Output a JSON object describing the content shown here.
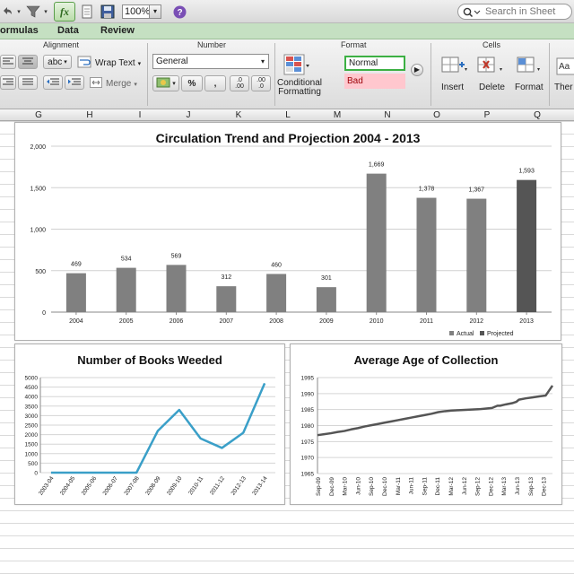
{
  "toolbar": {
    "zoom": "100%",
    "search_placeholder": "Search in Sheet",
    "icons": [
      "undo-icon",
      "filter-icon",
      "fx-icon",
      "document-icon",
      "save-icon",
      "help-icon"
    ]
  },
  "tabs": [
    "ormulas",
    "Data",
    "Review"
  ],
  "ribbon": {
    "alignment": {
      "title": "Alignment",
      "wrap_text": "Wrap Text",
      "merge": "Merge",
      "abc": "abc"
    },
    "number": {
      "title": "Number",
      "format": "General",
      "percent": "%",
      "comma": ",",
      "dec_inc": ".0\n.00",
      "dec_dec": ".00\n.0"
    },
    "format": {
      "title": "Format",
      "conditional": "Conditional Formatting",
      "normal": "Normal",
      "bad": "Bad"
    },
    "cells": {
      "title": "Cells",
      "insert": "Insert",
      "delete": "Delete",
      "format": "Format"
    },
    "themes": {
      "label": "Ther"
    }
  },
  "columns": [
    "G",
    "H",
    "I",
    "J",
    "K",
    "L",
    "M",
    "N",
    "O",
    "P",
    "Q"
  ],
  "chart_data": [
    {
      "type": "bar",
      "title": "Circulation Trend and Projection 2004 - 2013",
      "categories": [
        "2004",
        "2005",
        "2006",
        "2007",
        "2008",
        "2009",
        "2010",
        "2011",
        "2012",
        "2013"
      ],
      "values": [
        469,
        534,
        569,
        312,
        460,
        301,
        1669,
        1378,
        1367,
        1593
      ],
      "value_labels": [
        "469",
        "534",
        "569",
        "312",
        "460",
        "301",
        "1,669",
        "1,378",
        "1,367",
        "1,593"
      ],
      "projected_from_index": 9,
      "ylim": [
        0,
        2000
      ],
      "yticks": [
        "0",
        "500",
        "1,000",
        "1,500",
        "2,000"
      ],
      "legend": [
        "Actual",
        "Projected"
      ],
      "legend_position": "bottom-right",
      "colors": {
        "actual": "#808080",
        "projected": "#555555"
      }
    },
    {
      "type": "line",
      "title": "Number of Books Weeded",
      "categories": [
        "2003-04",
        "2004-05",
        "2005-06",
        "2006-07",
        "2007-08",
        "2008-09",
        "2009-10",
        "2010-11",
        "2011-12",
        "2012-13",
        "2013-14"
      ],
      "values": [
        0,
        0,
        0,
        0,
        0,
        2200,
        3300,
        1800,
        1300,
        2100,
        4700
      ],
      "ylim": [
        0,
        5000
      ],
      "yticks": [
        "0",
        "500",
        "1000",
        "1500",
        "2000",
        "2500",
        "3000",
        "3500",
        "4000",
        "4500",
        "5000"
      ],
      "color": "#3a9fc8"
    },
    {
      "type": "line",
      "title": "Average Age of Collection",
      "categories": [
        "Sep-09",
        "Dec-09",
        "Mar-10",
        "Jun-10",
        "Sep-10",
        "Dec-10",
        "Mar-11",
        "Jun-11",
        "Sep-11",
        "Dec-11",
        "Mar-12",
        "Jun-12",
        "Sep-12",
        "Dec-12",
        "Mar-13",
        "Jun-13",
        "Sep-13",
        "Dec-13"
      ],
      "series_x": [
        0,
        0.5,
        1,
        1.5,
        2,
        2.5,
        3,
        3.5,
        4,
        4.5,
        5,
        5.5,
        6,
        6.5,
        7,
        7.5,
        8,
        8.5,
        9,
        9.5,
        10,
        10.5,
        11,
        11.5,
        12,
        12.5,
        13,
        13.4,
        13.6,
        14,
        14.5,
        14.8,
        15,
        15.5,
        16,
        16.5,
        17,
        17.5
      ],
      "series_y": [
        1977,
        1977.3,
        1977.6,
        1978,
        1978.3,
        1978.8,
        1979.2,
        1979.7,
        1980.1,
        1980.5,
        1980.9,
        1981.3,
        1981.7,
        1982.1,
        1982.5,
        1982.9,
        1983.3,
        1983.7,
        1984.2,
        1984.5,
        1984.7,
        1984.8,
        1984.9,
        1985,
        1985.1,
        1985.3,
        1985.5,
        1986.2,
        1986.2,
        1986.6,
        1987,
        1987.4,
        1988.1,
        1988.5,
        1988.8,
        1989.1,
        1989.4,
        1992.5
      ],
      "ylim": [
        1965,
        1995
      ],
      "yticks": [
        "1965",
        "1970",
        "1975",
        "1980",
        "1985",
        "1990",
        "1995"
      ],
      "color": "#555555"
    }
  ]
}
